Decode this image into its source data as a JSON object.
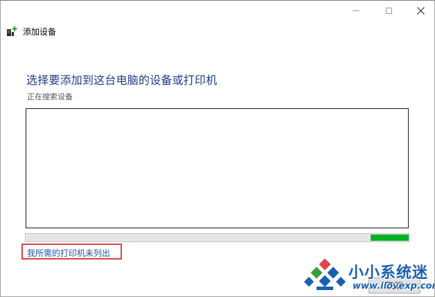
{
  "window": {
    "controls": {
      "minimize_icon": "minimize-icon",
      "maximize_icon": "maximize-icon",
      "close_icon": "close-icon"
    }
  },
  "wizard": {
    "icon": "add-device-icon",
    "title": "添加设备"
  },
  "main": {
    "heading": "选择要添加到这台电脑的设备或打印机",
    "status": "正在搜索设备",
    "device_list": {
      "items": []
    },
    "progress": {
      "animation": "searching",
      "visible_segment_start": 0.9,
      "visible_segment_end": 1.0,
      "color": "#06b025"
    },
    "printer_not_listed_link": "我所需的打印机未列出",
    "highlight_color": "#e04040"
  },
  "footer": {
    "cancel_label": "取消"
  },
  "watermark": {
    "title": "小小系统迷",
    "url": "www.ilovexp.com"
  },
  "colors": {
    "heading": "#1e3a8c",
    "link": "#1d57a8",
    "progress": "#06b025",
    "watermark": "#1a5fb4"
  }
}
